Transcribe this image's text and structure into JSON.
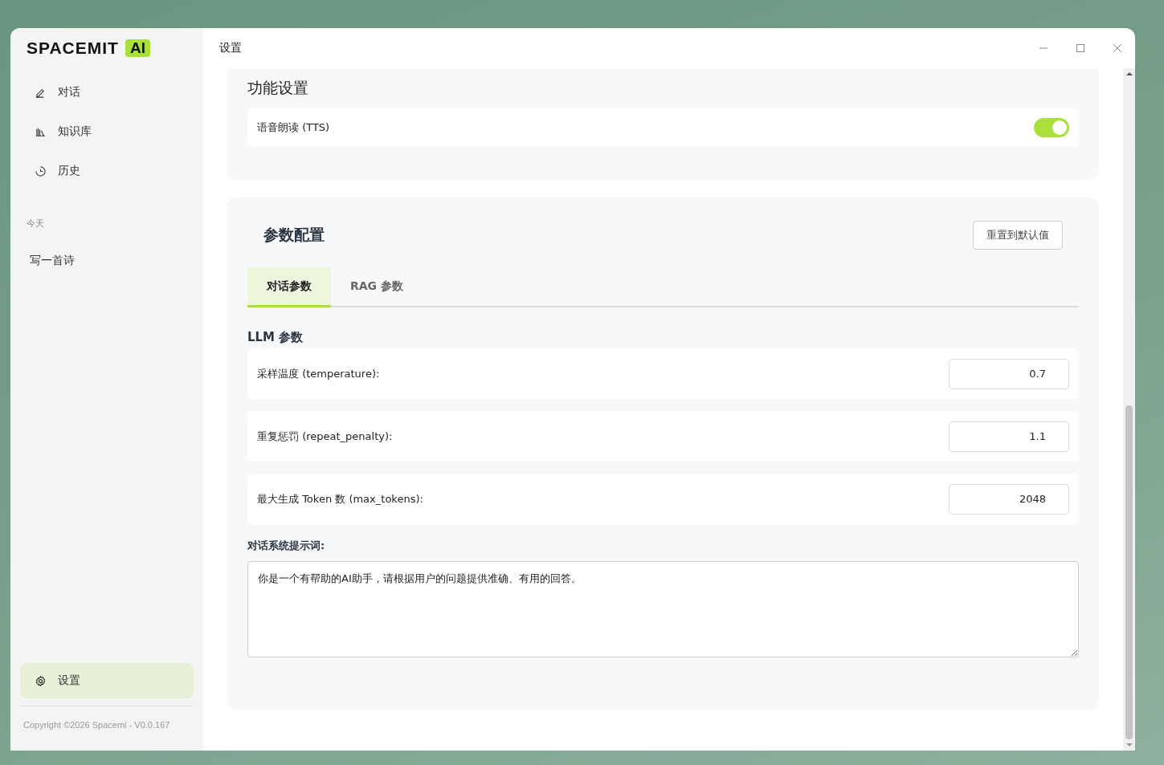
{
  "window": {
    "title": "设置"
  },
  "sidebar": {
    "logo": {
      "text": "SPACEMIT",
      "badge": "AI"
    },
    "nav": [
      {
        "label": "对话",
        "kind": "chat",
        "selected": false
      },
      {
        "label": "知识库",
        "kind": "library",
        "selected": false
      },
      {
        "label": "历史",
        "kind": "history",
        "selected": false
      }
    ],
    "history_group": "今天",
    "history": [
      {
        "label": "写一首诗"
      }
    ],
    "settings": {
      "label": "设置",
      "selected": true
    },
    "copyright": "Copyright ©2026 Spacemi - V0.0.167"
  },
  "features": {
    "title": "功能设置",
    "items": [
      {
        "label": "语音朗读 (TTS)",
        "on": true
      }
    ]
  },
  "params": {
    "title": "参数配置",
    "reset_button": "重置到默认值",
    "tabs": [
      {
        "label": "对话参数",
        "selected": true
      },
      {
        "label": "RAG 参数",
        "selected": false
      }
    ],
    "llm_title": "LLM 参数",
    "fields": [
      {
        "label": "采样温度 (temperature):",
        "value": "0.7"
      },
      {
        "label": "重复惩罚 (repeat_penalty):",
        "value": "1.1"
      },
      {
        "label": "最大生成 Token 数 (max_tokens):",
        "value": "2048"
      }
    ],
    "prompt_label": "对话系统提示词:",
    "prompt_value": "你是一个有帮助的AI助手，请根据用户的问题提供准确、有用的回答。"
  }
}
